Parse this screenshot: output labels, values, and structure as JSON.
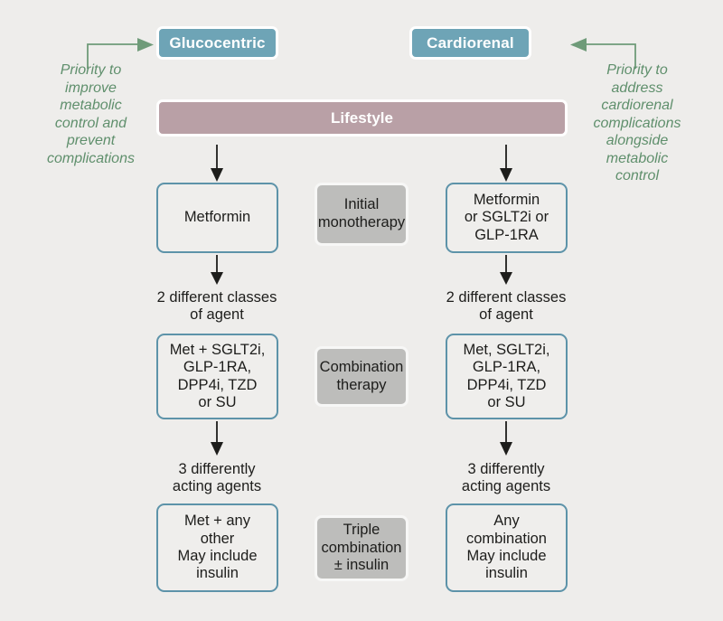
{
  "figure": {
    "background_color": "#eeedeb",
    "accent_blue": "#6ea4b6",
    "accent_rose": "#b9a0a6",
    "accent_gray": "#bdbdbb",
    "outline_blue": "#5d93a9",
    "note_green": "#5f8f6c"
  },
  "headers": {
    "left": "Glucocentric",
    "right": "Cardiorenal"
  },
  "side_notes": {
    "left": "Priority to improve metabolic control and prevent complications",
    "left_lines": [
      "Priority to",
      "improve",
      "metabolic",
      "control and",
      "prevent",
      "complications"
    ],
    "right": "Priority to address cardiorenal complications alongside metabolic control",
    "right_lines": [
      "Priority to",
      "address",
      "cardiorenal",
      "complications",
      "alongside",
      "metabolic",
      "control"
    ]
  },
  "lifestyle": {
    "label": "Lifestyle"
  },
  "stages": [
    {
      "center_label": "Initial monotherapy",
      "center_lines": [
        "Initial",
        "monotherapy"
      ],
      "left_caption": "",
      "right_caption": "",
      "left_box_lines": [
        "Metformin"
      ],
      "right_box_lines": [
        "Metformin",
        "or SGLT2i or",
        "GLP-1RA"
      ]
    },
    {
      "center_label": "Combination therapy",
      "center_lines": [
        "Combination",
        "therapy"
      ],
      "left_caption": "2 different classes of agent",
      "left_caption_lines": [
        "2 different classes",
        "of agent"
      ],
      "right_caption": "2 different classes of agent",
      "right_caption_lines": [
        "2 different classes",
        "of agent"
      ],
      "left_box_lines": [
        "Met + SGLT2i,",
        "GLP-1RA,",
        "DPP4i, TZD",
        "or SU"
      ],
      "right_box_lines": [
        "Met, SGLT2i,",
        "GLP-1RA,",
        "DPP4i, TZD",
        "or SU"
      ]
    },
    {
      "center_label": "Triple combination ± insulin",
      "center_lines": [
        "Triple",
        "combination",
        "± insulin"
      ],
      "left_caption": "3 differently acting agents",
      "left_caption_lines": [
        "3 differently",
        "acting agents"
      ],
      "right_caption": "3 differently acting agents",
      "right_caption_lines": [
        "3 differently",
        "acting agents"
      ],
      "left_box_lines": [
        "Met + any",
        "other",
        "May include",
        "insulin"
      ],
      "right_box_lines": [
        "Any",
        "combination",
        "May include",
        "insulin"
      ]
    }
  ],
  "arrows": {
    "left_entry_icon": "arrow-right-icon",
    "right_entry_icon": "arrow-left-icon",
    "flow_icon": "arrow-down-icon"
  }
}
